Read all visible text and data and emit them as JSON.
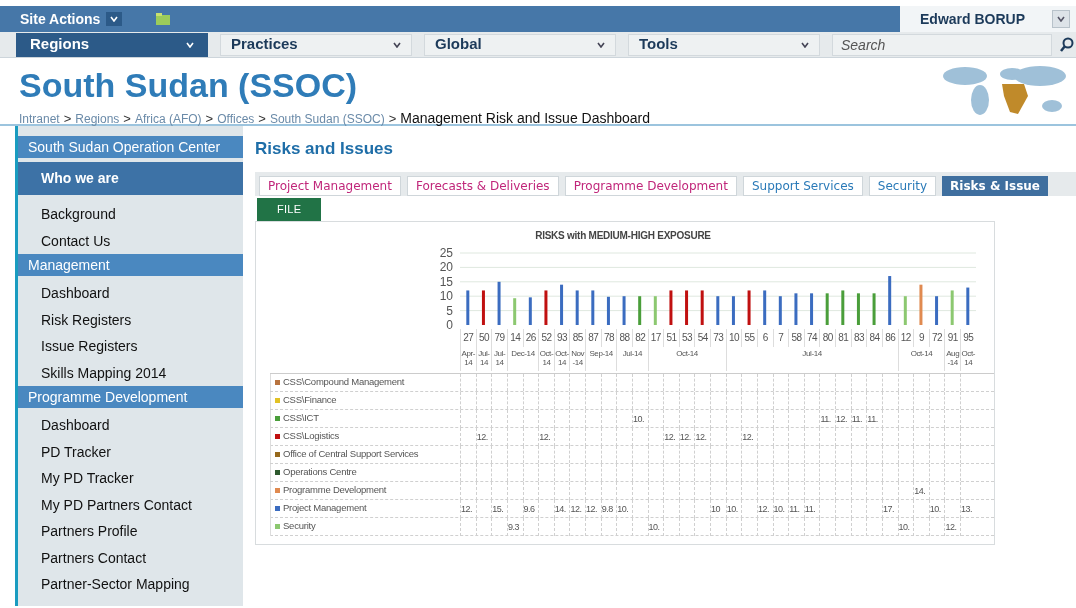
{
  "top_bar": {
    "site_actions": "Site Actions",
    "user": "Edward BORUP"
  },
  "nav": {
    "menus": [
      {
        "label": "Regions",
        "selected": true
      },
      {
        "label": "Practices",
        "selected": false
      },
      {
        "label": "Global",
        "selected": false
      },
      {
        "label": "Tools",
        "selected": false
      }
    ],
    "search": {
      "placeholder": "Search"
    }
  },
  "site_title": "South Sudan (SSOC)",
  "breadcrumb": [
    {
      "label": "Intranet",
      "current": false
    },
    {
      "separator": ">",
      "label": "Regions",
      "current": false
    },
    {
      "separator": ">",
      "label": "Africa (AFO)",
      "current": false
    },
    {
      "separator": ">",
      "label": "Offices",
      "current": false
    },
    {
      "separator": ">",
      "label": "South Sudan (SSOC)",
      "current": false
    },
    {
      "separator": ">",
      "label": "Management Risk and Issue Dashboard",
      "current": true
    }
  ],
  "sidebar": {
    "items": [
      {
        "kind": "header",
        "label": "South Sudan Operation Center"
      },
      {
        "kind": "link",
        "label": "Who we are",
        "selected": true
      },
      {
        "kind": "link",
        "label": "Background",
        "selected": false
      },
      {
        "kind": "link",
        "label": "Contact Us",
        "selected": false
      },
      {
        "kind": "header",
        "label": "Management"
      },
      {
        "kind": "link",
        "label": "Dashboard",
        "selected": false
      },
      {
        "kind": "link",
        "label": "Risk Registers",
        "selected": false
      },
      {
        "kind": "link",
        "label": "Issue Registers",
        "selected": false
      },
      {
        "kind": "link",
        "label": "Skills Mapping 2014",
        "selected": false
      },
      {
        "kind": "header",
        "label": "Programme Development"
      },
      {
        "kind": "link",
        "label": "Dashboard",
        "selected": false
      },
      {
        "kind": "link",
        "label": "PD Tracker",
        "selected": false
      },
      {
        "kind": "link",
        "label": "My PD Tracker",
        "selected": false
      },
      {
        "kind": "link",
        "label": "My PD Partners Contact",
        "selected": false
      },
      {
        "kind": "link",
        "label": "Partners Profile",
        "selected": false
      },
      {
        "kind": "link",
        "label": "Partners Contact",
        "selected": false
      },
      {
        "kind": "link",
        "label": "Partner-Sector Mapping",
        "selected": false
      }
    ]
  },
  "page_heading": "Risks and Issues",
  "tabs": [
    {
      "label": "Project Management",
      "selected": false,
      "color": "#c0267a"
    },
    {
      "label": "Forecasts & Deliveries",
      "selected": false,
      "color": "#c0267a"
    },
    {
      "label": "Programme Development",
      "selected": false,
      "color": "#c0267a"
    },
    {
      "label": "Support Services",
      "selected": false,
      "color": "#2a7ab8"
    },
    {
      "label": "Security",
      "selected": false,
      "color": "#2a7ab8"
    },
    {
      "label": "Risks & Issue",
      "selected": true
    }
  ],
  "file_button": "FILE",
  "chart": {
    "chart_data": {
      "type": "bar",
      "title": "RISKS with MEDIUM-HIGH EXPOSURE",
      "stacked": true,
      "grid": true,
      "legend": "left",
      "categories": [
        "27",
        "50",
        "79",
        "14",
        "26",
        "52",
        "93",
        "85",
        "87",
        "78",
        "88",
        "82",
        "17",
        "51",
        "53",
        "54",
        "73",
        "10",
        "55",
        "6",
        "7",
        "58",
        "74",
        "80",
        "81",
        "83",
        "84",
        "86",
        "12",
        "9",
        "72",
        "91",
        "95"
      ],
      "yticks": [
        0,
        5,
        10,
        15,
        20,
        25
      ],
      "ylim": [
        0,
        25
      ],
      "series": [
        {
          "name": "CSS\\Compound Management",
          "color": "#b8733e",
          "values": [
            null,
            null,
            null,
            null,
            null,
            null,
            null,
            null,
            null,
            null,
            null,
            null,
            null,
            null,
            null,
            null,
            null,
            null,
            null,
            null,
            null,
            null,
            null,
            null,
            null,
            null,
            null,
            null,
            null,
            null,
            null,
            null,
            null
          ]
        },
        {
          "name": "CSS\\Finance",
          "color": "#e2c225",
          "values": [
            null,
            null,
            null,
            null,
            null,
            null,
            null,
            null,
            null,
            null,
            null,
            null,
            null,
            null,
            null,
            null,
            null,
            null,
            null,
            null,
            null,
            null,
            null,
            null,
            null,
            null,
            null,
            null,
            null,
            null,
            null,
            null,
            null
          ]
        },
        {
          "name": "CSS\\ICT",
          "color": "#4a9e3a",
          "values": [
            null,
            null,
            null,
            null,
            null,
            null,
            null,
            null,
            null,
            null,
            null,
            10,
            null,
            null,
            null,
            null,
            null,
            null,
            null,
            null,
            null,
            null,
            null,
            11,
            12,
            11,
            11,
            null,
            null,
            null,
            null,
            null,
            null
          ]
        },
        {
          "name": "CSS\\Logistics",
          "color": "#c01010",
          "values": [
            null,
            12,
            null,
            null,
            null,
            12,
            null,
            null,
            null,
            null,
            null,
            null,
            null,
            12,
            12,
            12,
            null,
            null,
            12,
            null,
            null,
            null,
            null,
            null,
            null,
            null,
            null,
            null,
            null,
            null,
            null,
            null,
            null
          ]
        },
        {
          "name": "Office of Central Support Services",
          "color": "#96691c",
          "values": [
            null,
            null,
            null,
            null,
            null,
            null,
            null,
            null,
            null,
            null,
            null,
            null,
            null,
            null,
            null,
            null,
            null,
            null,
            null,
            null,
            null,
            null,
            null,
            null,
            null,
            null,
            null,
            null,
            null,
            null,
            null,
            null,
            null
          ]
        },
        {
          "name": "Operations Centre",
          "color": "#2e5a2e",
          "values": [
            null,
            null,
            null,
            null,
            null,
            null,
            null,
            null,
            null,
            null,
            null,
            null,
            null,
            null,
            null,
            null,
            null,
            null,
            null,
            null,
            null,
            null,
            null,
            null,
            null,
            null,
            null,
            null,
            null,
            null,
            null,
            null,
            null
          ]
        },
        {
          "name": "Programme Development",
          "color": "#e08a50",
          "values": [
            null,
            null,
            null,
            null,
            null,
            null,
            null,
            null,
            null,
            null,
            null,
            null,
            null,
            null,
            null,
            null,
            null,
            null,
            null,
            null,
            null,
            null,
            null,
            null,
            null,
            null,
            null,
            null,
            null,
            14,
            null,
            null,
            null
          ]
        },
        {
          "name": "Project Management",
          "color": "#3b6cc0",
          "values": [
            12,
            null,
            15,
            null,
            9.6,
            null,
            14,
            12,
            12,
            9.8,
            10,
            null,
            null,
            null,
            null,
            null,
            10,
            10,
            null,
            12,
            10,
            11,
            11,
            null,
            null,
            null,
            null,
            17,
            null,
            null,
            10,
            null,
            13
          ]
        },
        {
          "name": "Security",
          "color": "#8cc870",
          "values": [
            null,
            null,
            null,
            9.3,
            null,
            null,
            null,
            null,
            null,
            null,
            null,
            null,
            10,
            null,
            null,
            null,
            null,
            null,
            null,
            null,
            null,
            null,
            null,
            null,
            null,
            null,
            null,
            null,
            10,
            null,
            null,
            12,
            null
          ]
        }
      ]
    },
    "axis_groups": [
      {
        "label": "Apr-14"
      },
      {
        "label": "Jul-14"
      },
      {
        "label": "Jul-14"
      },
      {
        "label": "Dec-14"
      },
      {
        "label": "Oct-14"
      },
      {
        "label": "Oct-14"
      },
      {
        "label": "Nov-14"
      },
      {
        "label": "Sep-14"
      },
      {
        "label": "Jul-14"
      },
      {
        "label": "Oct-14"
      },
      {
        "label": "Jul-14"
      },
      {
        "label": "Oct-14"
      },
      {
        "label": "Aug-14"
      },
      {
        "label": "Oct-14"
      }
    ],
    "data_table": [
      {
        "cells": [
          null,
          null,
          null,
          null,
          null,
          null,
          null,
          null,
          null,
          null,
          null,
          null,
          null,
          null,
          null,
          null,
          null,
          null,
          null,
          null,
          null,
          null,
          null,
          null,
          null,
          null,
          null,
          null,
          null,
          null,
          null,
          null,
          null
        ]
      },
      {
        "cells": [
          null,
          null,
          null,
          null,
          null,
          null,
          null,
          null,
          null,
          null,
          null,
          null,
          null,
          null,
          null,
          null,
          null,
          null,
          null,
          null,
          null,
          null,
          null,
          null,
          null,
          null,
          null,
          null,
          null,
          null,
          null,
          null,
          null
        ]
      },
      {
        "cells": [
          null,
          null,
          null,
          null,
          null,
          null,
          null,
          null,
          null,
          null,
          null,
          "10.",
          null,
          null,
          null,
          null,
          null,
          null,
          null,
          null,
          null,
          null,
          null,
          "11.",
          "12.",
          "11.",
          "11.",
          null,
          null,
          null,
          null,
          null,
          null
        ]
      },
      {
        "cells": [
          null,
          "12.",
          null,
          null,
          null,
          "12.",
          null,
          null,
          null,
          null,
          null,
          null,
          null,
          "12.",
          "12.",
          "12.",
          null,
          null,
          "12.",
          null,
          null,
          null,
          null,
          null,
          null,
          null,
          null,
          null,
          null,
          null,
          null,
          null,
          null
        ]
      },
      {
        "cells": [
          null,
          null,
          null,
          null,
          null,
          null,
          null,
          null,
          null,
          null,
          null,
          null,
          null,
          null,
          null,
          null,
          null,
          null,
          null,
          null,
          null,
          null,
          null,
          null,
          null,
          null,
          null,
          null,
          null,
          null,
          null,
          null,
          null
        ]
      },
      {
        "cells": [
          null,
          null,
          null,
          null,
          null,
          null,
          null,
          null,
          null,
          null,
          null,
          null,
          null,
          null,
          null,
          null,
          null,
          null,
          null,
          null,
          null,
          null,
          null,
          null,
          null,
          null,
          null,
          null,
          null,
          null,
          null,
          null,
          null
        ]
      },
      {
        "cells": [
          null,
          null,
          null,
          null,
          null,
          null,
          null,
          null,
          null,
          null,
          null,
          null,
          null,
          null,
          null,
          null,
          null,
          null,
          null,
          null,
          null,
          null,
          null,
          null,
          null,
          null,
          null,
          null,
          null,
          "14.",
          null,
          null,
          null
        ]
      },
      {
        "cells": [
          "12.",
          null,
          "15.",
          null,
          "9.6",
          null,
          "14.",
          "12.",
          "12.",
          "9.8",
          "10.",
          null,
          null,
          null,
          null,
          null,
          "10",
          "10.",
          null,
          "12.",
          "10.",
          "11.",
          "11.",
          null,
          null,
          null,
          null,
          "17.",
          null,
          null,
          "10.",
          null,
          "13."
        ]
      },
      {
        "cells": [
          null,
          null,
          null,
          "9.3",
          null,
          null,
          null,
          null,
          null,
          null,
          null,
          null,
          "10.",
          null,
          null,
          null,
          null,
          null,
          null,
          null,
          null,
          null,
          null,
          null,
          null,
          null,
          null,
          null,
          "10.",
          null,
          null,
          "12.",
          null
        ]
      }
    ]
  }
}
